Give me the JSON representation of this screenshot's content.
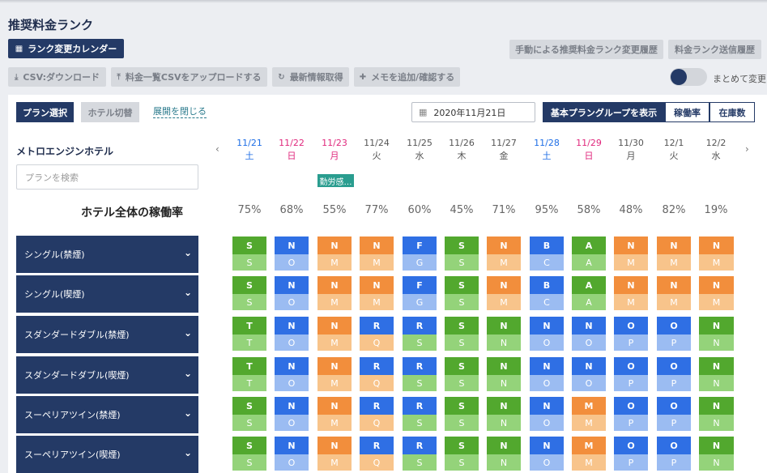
{
  "page": {
    "title": "推奨料金ランク"
  },
  "toolbar": {
    "calendar_button": "ランク変更カレンダー",
    "manual_history": "手動による推奨料金ランク変更履歴",
    "send_history": "料金ランク送信履歴",
    "csv_download": "CSV:ダウンロード",
    "csv_upload": "料金一覧CSVをアップロードする",
    "refresh": "最新情報取得",
    "memo": "メモを追加/確認する",
    "bulk_toggle_label": "まとめて変更"
  },
  "filters": {
    "plan_select": "プラン選択",
    "hotel_switch": "ホテル切替",
    "collapse": "展開を閉じる",
    "date": "2020年11月21日",
    "view_modes": [
      "基本プラングループを表示",
      "稼働率",
      "在庫数"
    ],
    "active_view": 0
  },
  "hotel": {
    "name": "メトロエンジンホテル",
    "search_placeholder": "プランを検索"
  },
  "days": [
    {
      "date": "11/21",
      "dow": "土",
      "type": "sat"
    },
    {
      "date": "11/22",
      "dow": "日",
      "type": "sun"
    },
    {
      "date": "11/23",
      "dow": "月",
      "type": "hol"
    },
    {
      "date": "11/24",
      "dow": "火",
      "type": "wd"
    },
    {
      "date": "11/25",
      "dow": "水",
      "type": "wd"
    },
    {
      "date": "11/26",
      "dow": "木",
      "type": "wd"
    },
    {
      "date": "11/27",
      "dow": "金",
      "type": "wd"
    },
    {
      "date": "11/28",
      "dow": "土",
      "type": "sat"
    },
    {
      "date": "11/29",
      "dow": "日",
      "type": "sun"
    },
    {
      "date": "11/30",
      "dow": "月",
      "type": "wd"
    },
    {
      "date": "12/1",
      "dow": "火",
      "type": "wd"
    },
    {
      "date": "12/2",
      "dow": "水",
      "type": "wd"
    }
  ],
  "event": {
    "day_index": 2,
    "label": "勤労感…"
  },
  "occupancy": {
    "label": "ホテル全体の稼働率",
    "values": [
      "75%",
      "68%",
      "55%",
      "77%",
      "60%",
      "45%",
      "71%",
      "95%",
      "58%",
      "48%",
      "82%",
      "19%"
    ]
  },
  "plans": [
    {
      "name": "シングル(禁煙)",
      "top": [
        "S",
        "N",
        "N",
        "N",
        "F",
        "S",
        "N",
        "B",
        "A",
        "N",
        "N",
        "N"
      ],
      "bottom": [
        "S",
        "O",
        "M",
        "M",
        "G",
        "S",
        "M",
        "C",
        "A",
        "M",
        "M",
        "M"
      ]
    },
    {
      "name": "シングル(喫煙)",
      "top": [
        "S",
        "N",
        "N",
        "N",
        "F",
        "S",
        "N",
        "B",
        "A",
        "N",
        "N",
        "N"
      ],
      "bottom": [
        "S",
        "O",
        "M",
        "M",
        "G",
        "S",
        "M",
        "C",
        "A",
        "M",
        "M",
        "M"
      ]
    },
    {
      "name": "スダンダードダブル(禁煙)",
      "top": [
        "T",
        "N",
        "N",
        "R",
        "R",
        "S",
        "N",
        "N",
        "N",
        "O",
        "O",
        "N"
      ],
      "bottom": [
        "T",
        "O",
        "M",
        "Q",
        "S",
        "S",
        "N",
        "O",
        "O",
        "P",
        "P",
        "N"
      ]
    },
    {
      "name": "スダンダードダブル(喫煙)",
      "top": [
        "T",
        "N",
        "N",
        "R",
        "R",
        "S",
        "N",
        "N",
        "N",
        "O",
        "O",
        "N"
      ],
      "bottom": [
        "T",
        "O",
        "M",
        "Q",
        "S",
        "S",
        "N",
        "O",
        "O",
        "P",
        "P",
        "N"
      ]
    },
    {
      "name": "スーペリアツイン(禁煙)",
      "top": [
        "S",
        "N",
        "N",
        "R",
        "R",
        "S",
        "N",
        "N",
        "M",
        "O",
        "O",
        "N"
      ],
      "bottom": [
        "S",
        "O",
        "M",
        "Q",
        "S",
        "S",
        "N",
        "O",
        "M",
        "P",
        "P",
        "N"
      ]
    },
    {
      "name": "スーペリアツイン(喫煙)",
      "top": [
        "S",
        "N",
        "N",
        "R",
        "R",
        "S",
        "N",
        "N",
        "M",
        "O",
        "O",
        "N"
      ],
      "bottom": [
        "S",
        "O",
        "M",
        "Q",
        "S",
        "S",
        "N",
        "O",
        "M",
        "P",
        "P",
        "N"
      ]
    }
  ],
  "colors": {
    "green": "#52a82e",
    "green_light": "#94d37a",
    "blue": "#2f6fe4",
    "blue_light": "#9bbcf2",
    "orange": "#f28e3c",
    "orange_light": "#f8c48b",
    "navy": "#243a66"
  },
  "cell_colors": {
    "A": "green",
    "S": "green",
    "T": "green",
    "B": "blue",
    "C": "blue",
    "F": "blue",
    "G": "blue",
    "O": "blue",
    "P": "blue",
    "R": "blue",
    "M": "orange",
    "Q": "orange",
    "N": "dynamic"
  }
}
